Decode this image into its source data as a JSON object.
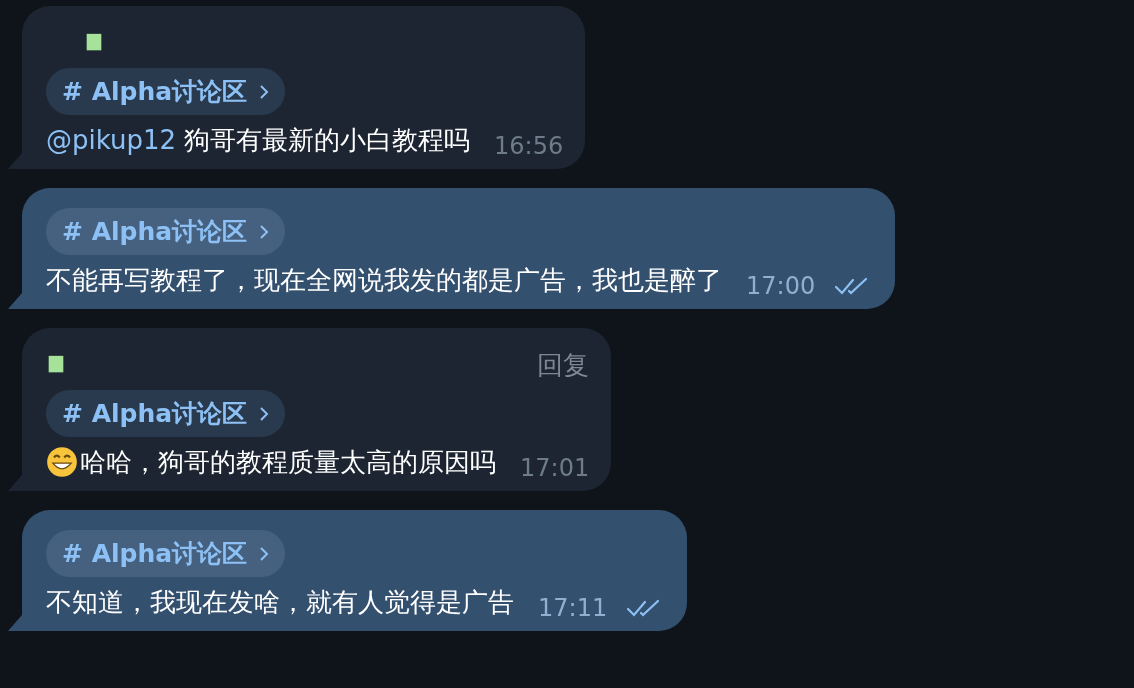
{
  "messages": [
    {
      "kind": "in",
      "sender_mark": true,
      "tag": "# Alpha讨论区",
      "mention": "@pikup12",
      "text": "狗哥有最新的小白教程吗",
      "emoji": false,
      "time": "16:56",
      "read": false
    },
    {
      "kind": "out",
      "sender_mark": false,
      "tag": "# Alpha讨论区",
      "text": "不能再写教程了，现在全网说我发的都是广告，我也是醉了",
      "emoji": false,
      "time": "17:00",
      "read": true
    },
    {
      "kind": "in",
      "sender_mark": true,
      "reply_label": "回复",
      "tag": "# Alpha讨论区",
      "text": "哈哈，狗哥的教程质量太高的原因吗",
      "emoji": true,
      "time": "17:01",
      "read": false
    },
    {
      "kind": "out",
      "sender_mark": false,
      "tag": "# Alpha讨论区",
      "text": "不知道，我现在发啥，就有人觉得是广告",
      "emoji": false,
      "time": "17:11",
      "read": true
    }
  ]
}
